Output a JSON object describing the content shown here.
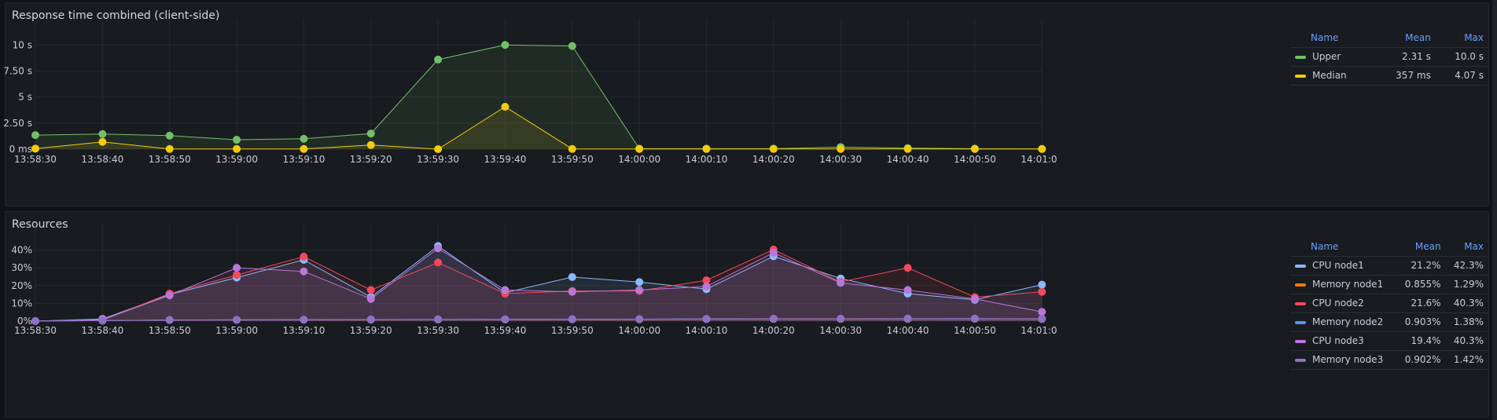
{
  "panels": {
    "response": {
      "title": "Response time combined (client-side)"
    },
    "resources": {
      "title": "Resources"
    }
  },
  "legend_headers": {
    "name": "Name",
    "mean": "Mean",
    "max": "Max"
  },
  "chart_data": [
    {
      "type": "line",
      "title": "Response time combined (client-side)",
      "x": [
        "13:58:30",
        "13:58:40",
        "13:58:50",
        "13:59:00",
        "13:59:10",
        "13:59:20",
        "13:59:30",
        "13:59:40",
        "13:59:50",
        "14:00:00",
        "14:00:10",
        "14:00:20",
        "14:00:30",
        "14:00:40",
        "14:00:50",
        "14:01:00"
      ],
      "x_tick_labels": [
        "13:58:30",
        "13:58:40",
        "13:58:50",
        "13:59:00",
        "13:59:10",
        "13:59:20",
        "13:59:30",
        "13:59:40",
        "13:59:50",
        "14:00:00",
        "14:00:10",
        "14:00:20",
        "14:00:30",
        "14:00:40",
        "14:00:50",
        "14:01:0"
      ],
      "y_ticks": [
        0,
        2.5,
        5,
        7.5,
        10
      ],
      "y_tick_labels": [
        "0 ms",
        "2.50 s",
        "5 s",
        "7.50 s",
        "10 s"
      ],
      "ylim": [
        0,
        11
      ],
      "grid": true,
      "legend_position": "right",
      "series": [
        {
          "name": "Upper",
          "color": "#73bf69",
          "mean": "2.31 s",
          "max": "10.0 s",
          "values": [
            1.35,
            1.45,
            1.3,
            0.9,
            1.0,
            1.5,
            8.6,
            10.0,
            9.9,
            0.05,
            0.05,
            0.05,
            0.2,
            0.1,
            0.05,
            0.02
          ]
        },
        {
          "name": "Median",
          "color": "#f2cc0c",
          "mean": "357 ms",
          "max": "4.07 s",
          "values": [
            0.05,
            0.7,
            0.02,
            0.02,
            0.02,
            0.4,
            0.0,
            4.07,
            0.02,
            0.02,
            0.02,
            0.02,
            0.02,
            0.02,
            0.02,
            0.02
          ]
        }
      ]
    },
    {
      "type": "line",
      "title": "Resources",
      "x": [
        "13:58:30",
        "13:58:40",
        "13:58:50",
        "13:59:00",
        "13:59:10",
        "13:59:20",
        "13:59:30",
        "13:59:40",
        "13:59:50",
        "14:00:00",
        "14:00:10",
        "14:00:20",
        "14:00:30",
        "14:00:40",
        "14:00:50",
        "14:01:00"
      ],
      "x_tick_labels": [
        "13:58:30",
        "13:58:40",
        "13:58:50",
        "13:59:00",
        "13:59:10",
        "13:59:20",
        "13:59:30",
        "13:59:40",
        "13:59:50",
        "14:00:00",
        "14:00:10",
        "14:00:20",
        "14:00:30",
        "14:00:40",
        "14:00:50",
        "14:01:0"
      ],
      "y_ticks": [
        0,
        10,
        20,
        30,
        40
      ],
      "y_tick_labels": [
        "0%",
        "10%",
        "20%",
        "30%",
        "40%"
      ],
      "ylim": [
        0,
        46
      ],
      "grid": true,
      "legend_position": "right",
      "series": [
        {
          "name": "CPU node1",
          "color": "#8ab8ff",
          "mean": "21.2%",
          "max": "42.3%",
          "values": [
            0,
            1.2,
            15,
            24.5,
            34.5,
            13.5,
            42.3,
            16,
            24.8,
            22,
            18,
            36.5,
            24,
            15.5,
            12,
            20.5
          ]
        },
        {
          "name": "Memory node1",
          "color": "#ff780a",
          "mean": "0.855%",
          "max": "1.29%",
          "values": [
            0,
            0.3,
            0.6,
            0.7,
            0.8,
            0.8,
            0.9,
            0.9,
            1.0,
            1.0,
            1.1,
            1.2,
            1.2,
            1.25,
            1.29,
            1.2
          ]
        },
        {
          "name": "CPU node2",
          "color": "#f2495c",
          "mean": "21.6%",
          "max": "40.3%",
          "values": [
            0,
            0.5,
            15.5,
            26,
            36.3,
            17.5,
            33,
            15.5,
            17,
            17,
            23,
            40.3,
            22,
            30,
            13.5,
            16.5
          ]
        },
        {
          "name": "Memory node2",
          "color": "#5794f2",
          "mean": "0.903%",
          "max": "1.38%",
          "values": [
            0,
            0.3,
            0.6,
            0.7,
            0.8,
            0.9,
            0.9,
            1.0,
            1.0,
            1.1,
            1.2,
            1.3,
            1.3,
            1.35,
            1.38,
            1.3
          ]
        },
        {
          "name": "CPU node3",
          "color": "#b877d9",
          "mean": "19.4%",
          "max": "40.3%",
          "values": [
            0,
            0.8,
            14.5,
            30,
            28,
            12.5,
            41,
            17.5,
            16.5,
            17.5,
            19.5,
            38.5,
            21.5,
            17.5,
            12.5,
            5.2
          ]
        },
        {
          "name": "Memory node3",
          "color": "#8f6fc7",
          "mean": "0.902%",
          "max": "1.42%",
          "values": [
            0,
            0.3,
            0.6,
            0.7,
            0.8,
            0.9,
            1.0,
            1.0,
            1.1,
            1.1,
            1.2,
            1.3,
            1.3,
            1.4,
            1.42,
            1.3
          ]
        }
      ]
    }
  ]
}
